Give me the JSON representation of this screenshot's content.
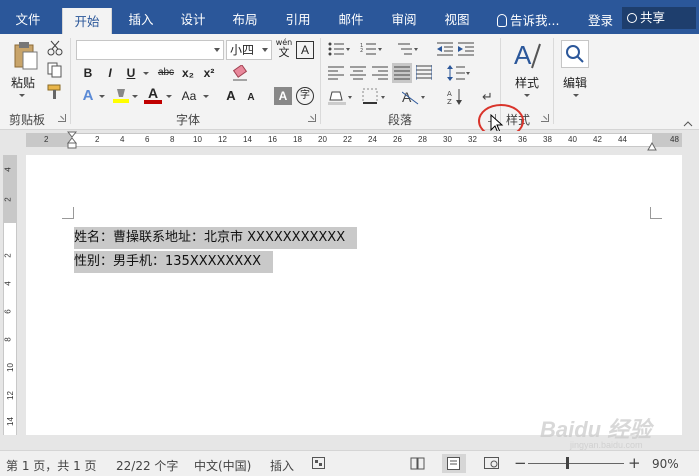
{
  "tabs": [
    "文件",
    "开始",
    "插入",
    "设计",
    "布局",
    "引用",
    "邮件",
    "审阅",
    "视图"
  ],
  "active_tab": "开始",
  "tell_me": "告诉我...",
  "login": "登录",
  "share": "共享",
  "ribbon": {
    "clipboard": {
      "paste": "粘贴",
      "label": "剪贴板"
    },
    "font": {
      "font_name": "",
      "font_size": "小四",
      "phonetic_top": "wén",
      "phonetic_bottom": "文",
      "char_border": "A",
      "bold": "B",
      "italic": "I",
      "underline": "U",
      "strike": "abc",
      "subscript": "x₂",
      "superscript": "x²",
      "grow": "A",
      "shrink": "A",
      "change_case": "Aa",
      "text_effect": "A",
      "font_color": "A",
      "shading": "A",
      "enclose": "字",
      "label": "字体"
    },
    "paragraph": {
      "label": "段落"
    },
    "styles": {
      "button": "样式",
      "label": "样式"
    },
    "editing": {
      "button": "编辑"
    }
  },
  "ruler": {
    "h_numbers": [
      "2",
      "2",
      "4",
      "6",
      "8",
      "10",
      "12",
      "14",
      "16",
      "18",
      "20",
      "22",
      "24",
      "26",
      "28",
      "30",
      "32",
      "34",
      "36",
      "38",
      "40",
      "42",
      "44",
      "48"
    ],
    "v_numbers": [
      "4",
      "2",
      "2",
      "4",
      "6",
      "8",
      "10",
      "12",
      "14"
    ]
  },
  "document": {
    "lines": [
      "姓名：曹操联系地址：北京市 XXXXXXXXXXX",
      "性别：男手机：135XXXXXXXX"
    ]
  },
  "status": {
    "page": "第 1 页，共 1 页",
    "words": "22/22 个字",
    "language": "中文(中国)",
    "mode": "插入",
    "zoom": "90%",
    "minus": "−",
    "plus": "+"
  },
  "watermark": {
    "main": "Baidu 经验",
    "sub": "jingyan.baidu.com"
  },
  "colors": {
    "accent": "#2b579a",
    "highlight": "#ffff00",
    "font_color": "#c00000",
    "circle": "#d9342b"
  }
}
